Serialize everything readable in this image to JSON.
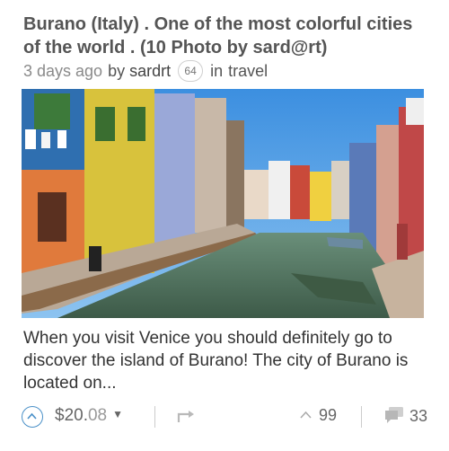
{
  "post": {
    "title": "Burano (Italy) . One of the most colorful cities of the world . (10 Photo by sard@rt)",
    "age": "3 days ago",
    "by_label": "by",
    "author": "sardrt",
    "reputation": "64",
    "in_label": "in",
    "category": "travel",
    "image_alt": "Colorful houses along a canal in Burano",
    "excerpt": "When you visit Venice you should definitely go to discover the island of Burano! The city of Burano is located on..."
  },
  "footer": {
    "payout_whole": "$20.",
    "payout_cents": "08",
    "payout_caret": "▼",
    "votes": "99",
    "comments": "33"
  },
  "icons": {
    "vote": "upvote-chevron-icon",
    "reblog": "reblog-icon",
    "votes": "chevron-up-icon",
    "comments": "comment-bubble-icon"
  },
  "colors": {
    "accent": "#4a90c8"
  }
}
